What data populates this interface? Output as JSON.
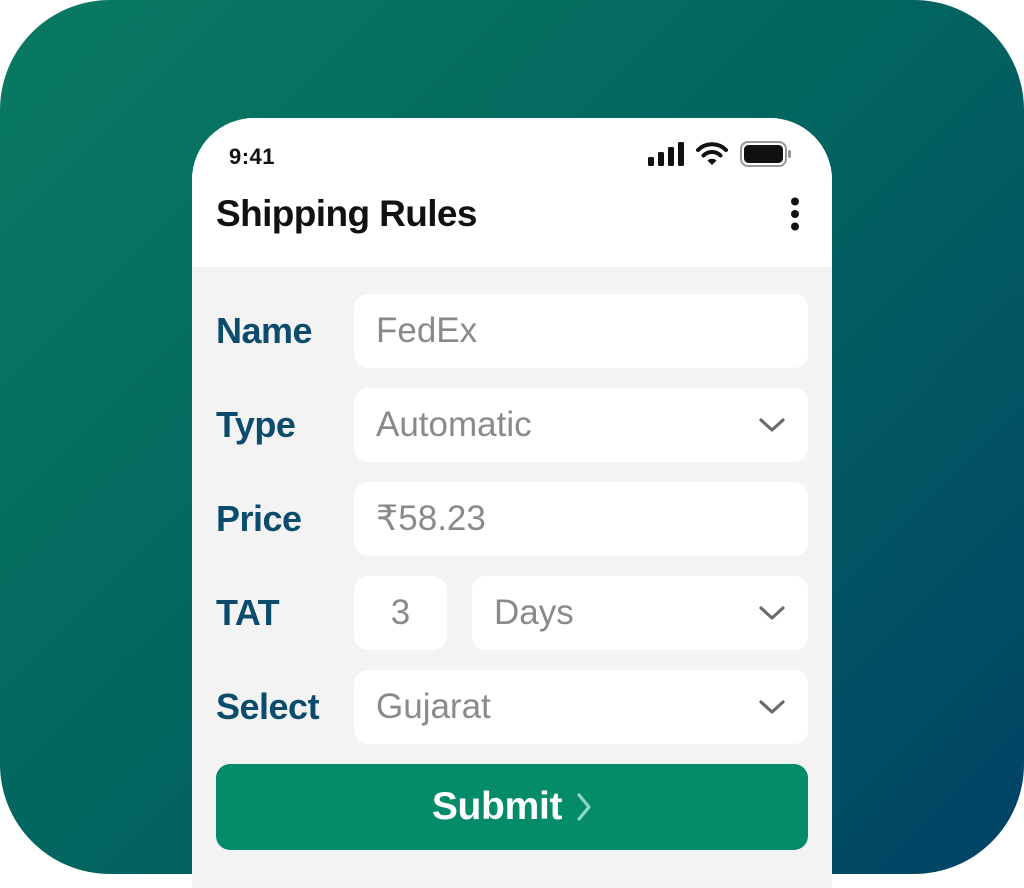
{
  "status_bar": {
    "time": "9:41",
    "icons": [
      "cellular-signal-icon",
      "wifi-icon",
      "battery-icon"
    ]
  },
  "header": {
    "title": "Shipping Rules",
    "menu_icon": "more-vertical-icon"
  },
  "form": {
    "name": {
      "label": "Name",
      "value": "FedEx"
    },
    "type": {
      "label": "Type",
      "value": "Automatic",
      "icon": "chevron-down-icon"
    },
    "price": {
      "label": "Price",
      "value": "₹58.23"
    },
    "tat": {
      "label": "TAT",
      "amount": "3",
      "unit": "Days",
      "icon": "chevron-down-icon"
    },
    "select": {
      "label": "Select",
      "value": "Gujarat",
      "icon": "chevron-down-icon"
    }
  },
  "submit": {
    "label": "Submit",
    "icon": "chevron-right-icon"
  },
  "colors": {
    "background_gradient_start": "#097a62",
    "background_gradient_end": "#014266",
    "label": "#0b4c6c",
    "field_text": "#8a8a8a",
    "submit_bg": "#038b6a",
    "form_bg": "#f3f3f3"
  }
}
